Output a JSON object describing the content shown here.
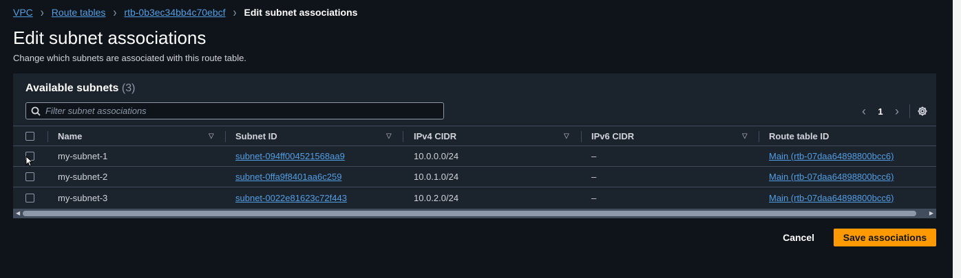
{
  "breadcrumb": {
    "items": [
      "VPC",
      "Route tables",
      "rtb-0b3ec34bb4c70ebcf"
    ],
    "current": "Edit subnet associations"
  },
  "page": {
    "title": "Edit subnet associations",
    "description": "Change which subnets are associated with this route table."
  },
  "panel": {
    "title": "Available subnets",
    "count": "(3)",
    "filter_placeholder": "Filter subnet associations",
    "page_number": "1"
  },
  "table": {
    "columns": [
      "Name",
      "Subnet ID",
      "IPv4 CIDR",
      "IPv6 CIDR",
      "Route table ID"
    ],
    "rows": [
      {
        "name": "my-subnet-1",
        "subnet_id": "subnet-094ff004521568aa9",
        "ipv4": "10.0.0.0/24",
        "ipv6": "–",
        "route_table": "Main (rtb-07daa64898800bcc6)"
      },
      {
        "name": "my-subnet-2",
        "subnet_id": "subnet-0ffa9f8401aa6c259",
        "ipv4": "10.0.1.0/24",
        "ipv6": "–",
        "route_table": "Main (rtb-07daa64898800bcc6)"
      },
      {
        "name": "my-subnet-3",
        "subnet_id": "subnet-0022e81623c72f443",
        "ipv4": "10.0.2.0/24",
        "ipv6": "–",
        "route_table": "Main (rtb-07daa64898800bcc6)"
      }
    ]
  },
  "actions": {
    "cancel": "Cancel",
    "save": "Save associations"
  },
  "colors": {
    "background": "#0f141a",
    "panel": "#1b232d",
    "link": "#539fe5",
    "primary": "#ff9900"
  }
}
